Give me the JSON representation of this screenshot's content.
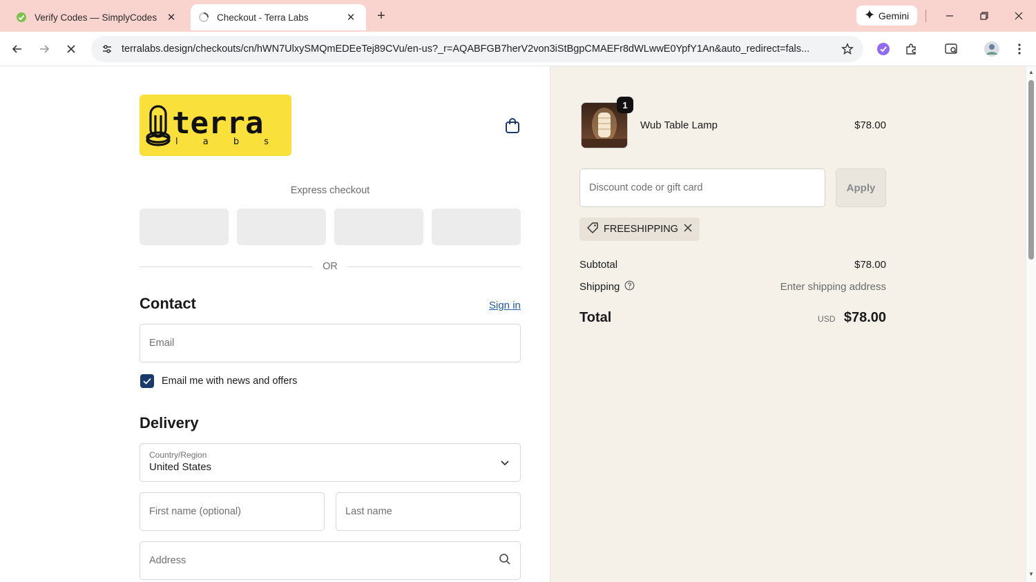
{
  "browser": {
    "tabs": [
      {
        "title": "Verify Codes — SimplyCodes",
        "favicon": "simplycodes-icon"
      },
      {
        "title": "Checkout - Terra Labs",
        "favicon": "loading-icon"
      }
    ],
    "new_tab_label": "+",
    "gemini_label": "Gemini",
    "url": "terralabs.design/checkouts/cn/hWN7UlxySMQmEDEeTej89CVu/en-us?_r=AQABFGB7herV2von3iStBgpCMAEFr8dWLwwE0YpfY1An&auto_redirect=fals..."
  },
  "header": {
    "logo_text": "terra",
    "logo_sub": "l a b s"
  },
  "express": {
    "label": "Express checkout",
    "or_label": "OR"
  },
  "contact": {
    "heading": "Contact",
    "sign_in": "Sign in",
    "email_placeholder": "Email",
    "newsletter_label": "Email me with news and offers",
    "newsletter_checked": true
  },
  "delivery": {
    "heading": "Delivery",
    "country_label": "Country/Region",
    "country_value": "United States",
    "first_name_placeholder": "First name (optional)",
    "last_name_placeholder": "Last name",
    "address_placeholder": "Address"
  },
  "summary": {
    "item": {
      "name": "Wub Table Lamp",
      "price": "$78.00",
      "quantity": "1"
    },
    "discount_placeholder": "Discount code or gift card",
    "apply_label": "Apply",
    "applied_code": "FREESHIPPING",
    "subtotal_label": "Subtotal",
    "subtotal_value": "$78.00",
    "shipping_label": "Shipping",
    "shipping_value": "Enter shipping address",
    "total_label": "Total",
    "total_currency": "USD",
    "total_value": "$78.00"
  },
  "colors": {
    "tabstrip": "#f9d3cd",
    "logo_bg": "#f9e03a",
    "summary_bg": "#f5f0e8",
    "link": "#1e5aa6",
    "checkbox": "#1a3a6b"
  }
}
